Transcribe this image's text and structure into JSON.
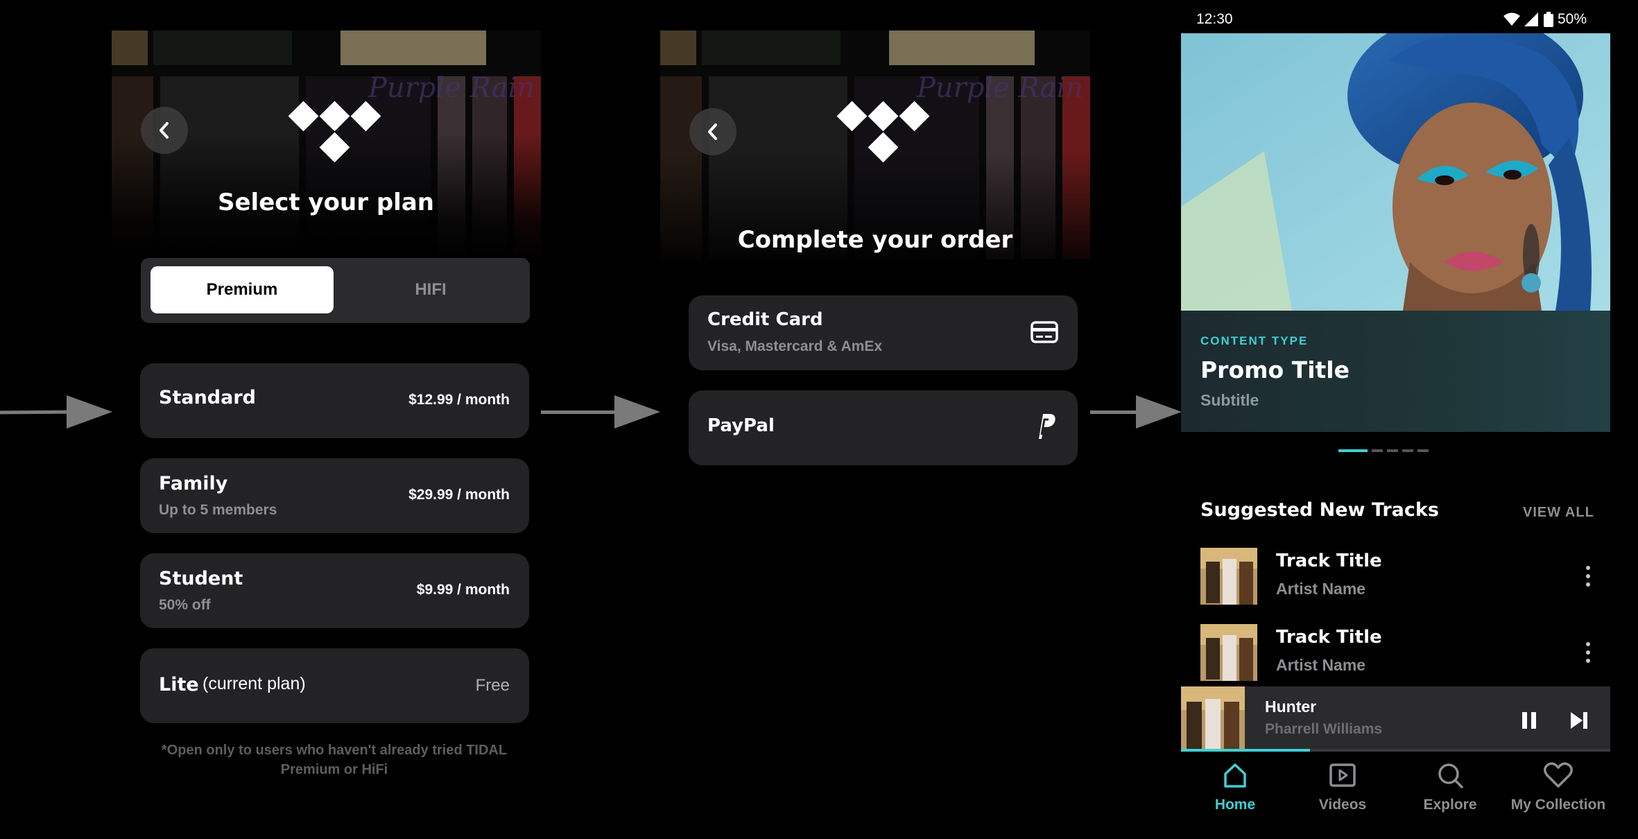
{
  "plan_screen": {
    "title": "Select your plan",
    "tabs": [
      {
        "label": "Premium",
        "active": true
      },
      {
        "label": "HIFI",
        "active": false
      }
    ],
    "plans": [
      {
        "name": "Standard",
        "subtitle": "",
        "price": "$12.99 / month"
      },
      {
        "name": "Family",
        "subtitle": "Up to 5 members",
        "price": "$29.99 / month"
      },
      {
        "name": "Student",
        "subtitle": "50% off",
        "price": "$9.99 / month"
      },
      {
        "name": "Lite",
        "annotation": "(current plan)",
        "price": "Free"
      }
    ],
    "footnote_line1": "*Open only to users who haven't already tried TIDAL",
    "footnote_line2": "Premium or HiFi"
  },
  "order_screen": {
    "title": "Complete your order",
    "methods": [
      {
        "name": "Credit Card",
        "subtitle": "Visa, Mastercard & AmEx",
        "icon": "credit-card-icon"
      },
      {
        "name": "PayPal",
        "subtitle": "",
        "icon": "paypal-icon"
      }
    ]
  },
  "home_screen": {
    "status": {
      "time": "12:30",
      "battery": "50%"
    },
    "promo": {
      "content_type": "CONTENT TYPE",
      "title": "Promo Title",
      "subtitle": "Subtitle",
      "pages": 5,
      "active_page": 1
    },
    "section": {
      "title": "Suggested New Tracks",
      "view_all": "VIEW ALL"
    },
    "tracks": [
      {
        "title": "Track Title",
        "artist": "Artist Name"
      },
      {
        "title": "Track Title",
        "artist": "Artist Name"
      }
    ],
    "now_playing": {
      "title": "Hunter",
      "artist": "Pharrell Williams",
      "progress": 0.3
    },
    "nav": [
      {
        "label": "Home",
        "icon": "home-icon",
        "active": true
      },
      {
        "label": "Videos",
        "icon": "video-icon",
        "active": false
      },
      {
        "label": "Explore",
        "icon": "search-icon",
        "active": false
      },
      {
        "label": "My Collection",
        "icon": "heart-icon",
        "active": false
      }
    ]
  },
  "colors": {
    "accent": "#3fd0d4",
    "card": "#232326",
    "background": "#000000",
    "muted": "#8e8e93"
  }
}
